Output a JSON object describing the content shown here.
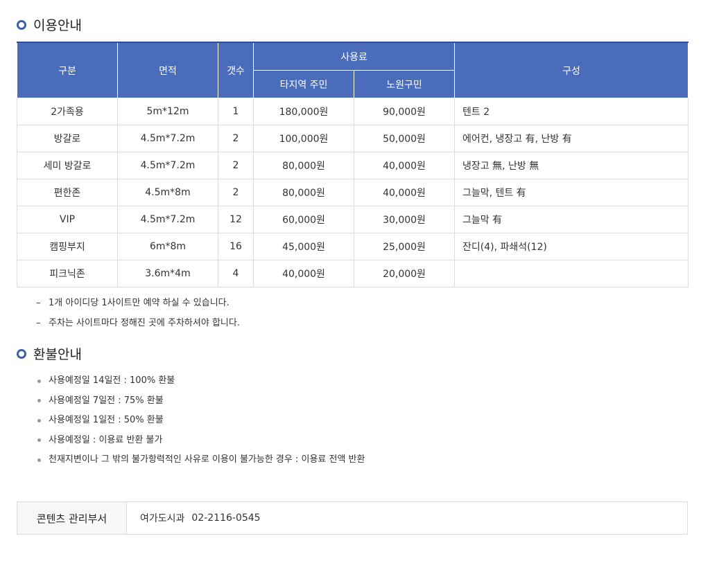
{
  "usage_section": {
    "title": "이용안내"
  },
  "table": {
    "headers": {
      "category": "구분",
      "area": "면적",
      "count": "갯수",
      "fee": "사용료",
      "fee_other": "타지역 주민",
      "fee_local": "노원구민",
      "composition": "구성"
    },
    "rows": [
      {
        "category": "2가족용",
        "area": "5m*12m",
        "count": "1",
        "fee_other": "180,000원",
        "fee_local": "90,000원",
        "composition": "텐트 2"
      },
      {
        "category": "방갈로",
        "area": "4.5m*7.2m",
        "count": "2",
        "fee_other": "100,000원",
        "fee_local": "50,000원",
        "composition": "에어컨, 냉장고 有, 난방 有"
      },
      {
        "category": "세미 방갈로",
        "area": "4.5m*7.2m",
        "count": "2",
        "fee_other": "80,000원",
        "fee_local": "40,000원",
        "composition": "냉장고 無, 난방 無"
      },
      {
        "category": "편한존",
        "area": "4.5m*8m",
        "count": "2",
        "fee_other": "80,000원",
        "fee_local": "40,000원",
        "composition": "그늘막, 텐트 有"
      },
      {
        "category": "VIP",
        "area": "4.5m*7.2m",
        "count": "12",
        "fee_other": "60,000원",
        "fee_local": "30,000원",
        "composition": "그늘막 有"
      },
      {
        "category": "캠핑부지",
        "area": "6m*8m",
        "count": "16",
        "fee_other": "45,000원",
        "fee_local": "25,000원",
        "composition": "잔디(4), 파쇄석(12)"
      },
      {
        "category": "피크닉존",
        "area": "3.6m*4m",
        "count": "4",
        "fee_other": "40,000원",
        "fee_local": "20,000원",
        "composition": ""
      }
    ]
  },
  "notes": [
    "1개 아이디당 1사이트만 예약 하실 수 있습니다.",
    "주차는 사이트마다 정해진 곳에 주차하셔야 합니다."
  ],
  "note_marker": "–",
  "refund_section": {
    "title": "환불안내",
    "items": [
      "사용예정일 14일전 : 100% 환불",
      "사용예정일 7일전 : 75% 환불",
      "사용예정일 1일전 : 50% 환불",
      "사용예정일 : 이용료 반환 불가",
      "천재지변이나 그 밖의 불가항력적인 사유로 이용이 불가능한 경우 : 이용료 전액 반환"
    ]
  },
  "department": {
    "label": "콘텐츠 관리부서",
    "name": "여가도시과",
    "phone": "02-2116-0545"
  },
  "colors": {
    "accent": "#3c5eab",
    "header_bg": "#4a6cbb",
    "border": "#dcdcdc",
    "bullet": "#999999"
  },
  "icons": {
    "section_marker": "ring-icon",
    "list_marker": "bullet-icon"
  }
}
